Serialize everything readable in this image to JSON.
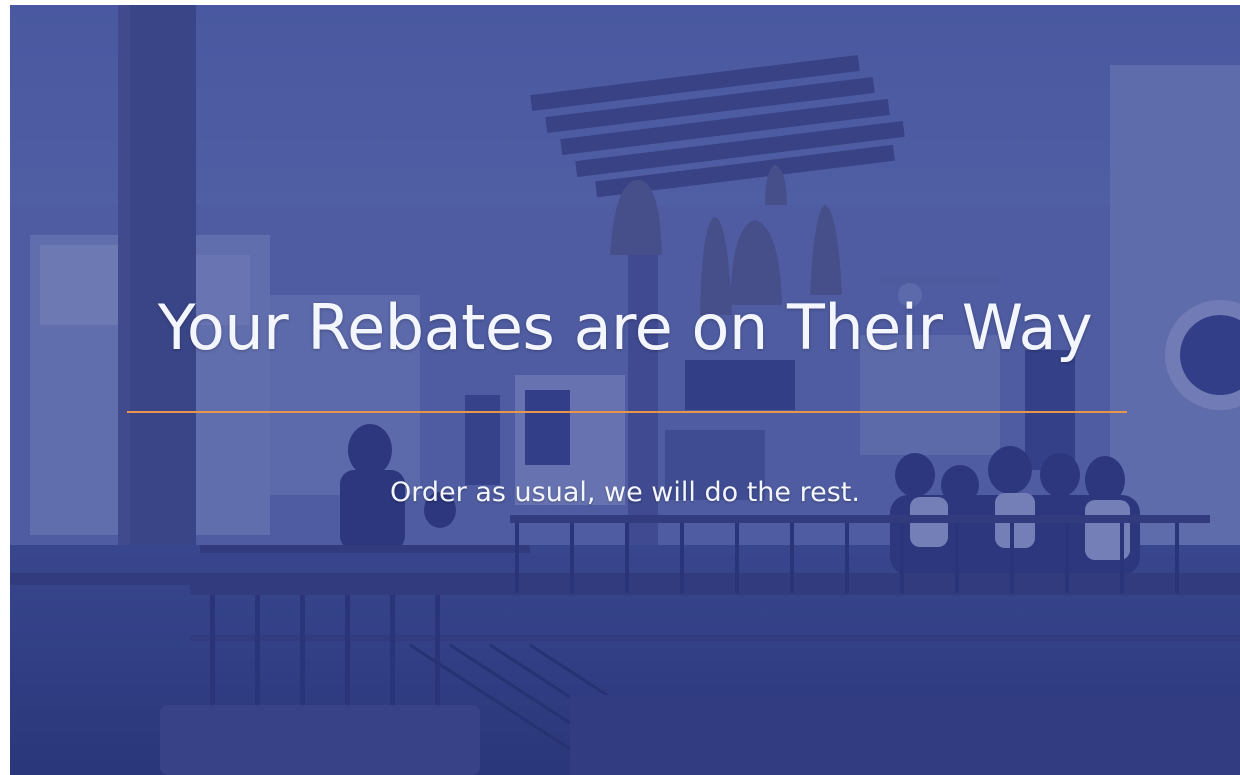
{
  "hero": {
    "headline": "Your Rebates are on Their Way",
    "subheadline": "Order as usual, we will do the rest."
  },
  "colors": {
    "overlay": "#2a388c",
    "divider": "#e8944a",
    "text": "#f4f6ff"
  },
  "background": {
    "icon": "cafe-interior-photo"
  }
}
